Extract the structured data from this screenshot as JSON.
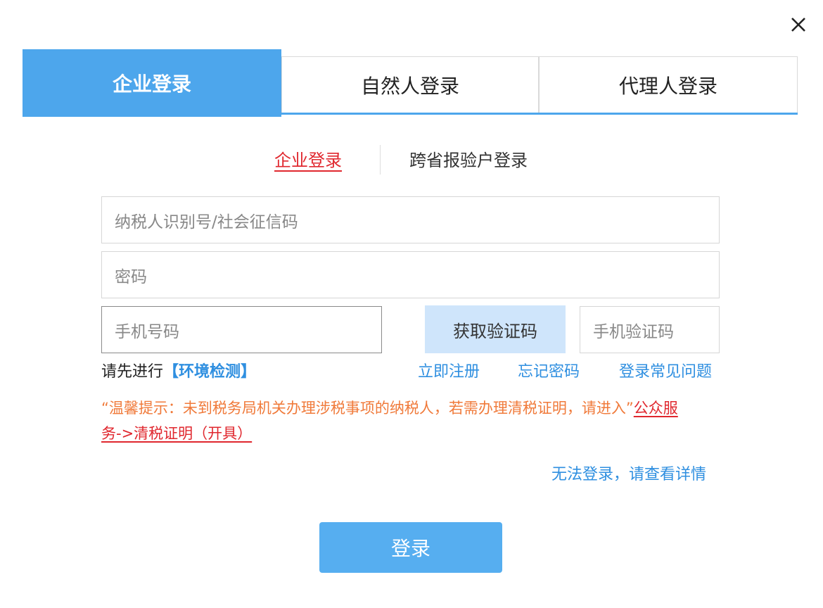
{
  "tabs": [
    {
      "label": "企业登录",
      "active": true
    },
    {
      "label": "自然人登录",
      "active": false
    },
    {
      "label": "代理人登录",
      "active": false
    }
  ],
  "subtabs": [
    {
      "label": "企业登录",
      "active": true
    },
    {
      "label": "跨省报验户登录",
      "active": false
    }
  ],
  "form": {
    "taxid_placeholder": "纳税人识别号/社会征信码",
    "password_placeholder": "密码",
    "phone_placeholder": "手机号码",
    "get_code_label": "获取验证码",
    "smscode_placeholder": "手机验证码"
  },
  "links": {
    "env_prefix": "请先进行",
    "env_check": "【环境检测】",
    "register": "立即注册",
    "forgot": "忘记密码",
    "faq": "登录常见问题",
    "help": "无法登录，请查看详情"
  },
  "notice": {
    "text": "“温馨提示：未到税务局机关办理涉税事项的纳税人，若需办理清税证明，请进入”",
    "link": "公众服务->清税证明（开具）"
  },
  "login_label": "登录",
  "colors": {
    "accent": "#4da6ec",
    "link": "#2f8fe0",
    "active_red": "#e0272e",
    "notice_orange": "#f07a3a",
    "code_button_bg": "#cfe5fb"
  },
  "icons": {
    "close": "close-icon"
  }
}
